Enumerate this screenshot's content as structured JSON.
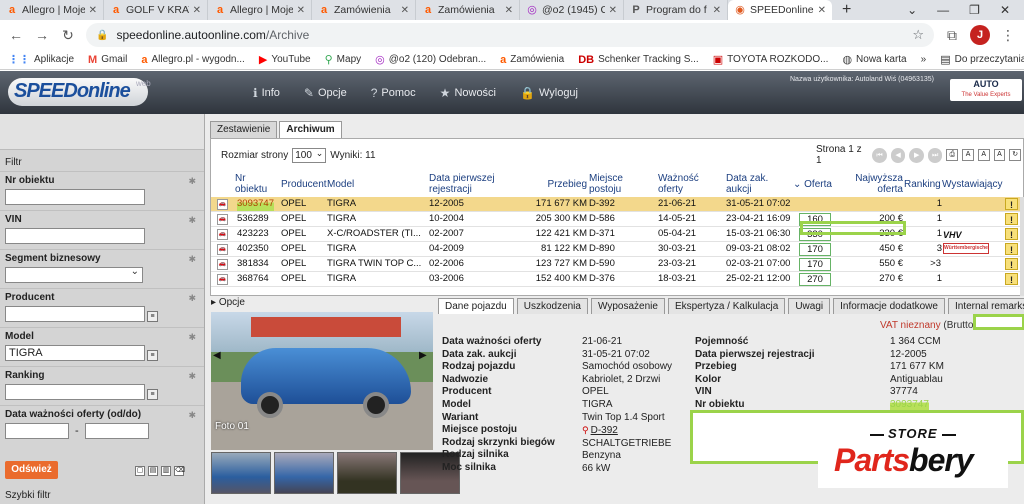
{
  "browser": {
    "tabs": [
      {
        "icon": "a",
        "label": "Allegro | Moje",
        "color": "#ff5a00",
        "active": false
      },
      {
        "icon": "a",
        "label": "GOLF V KRAT",
        "color": "#ff5a00",
        "active": false
      },
      {
        "icon": "a",
        "label": "Allegro | Moje",
        "color": "#ff5a00",
        "active": false
      },
      {
        "icon": "a",
        "label": "Zamówienia",
        "color": "#ff5a00",
        "active": false
      },
      {
        "icon": "a",
        "label": "Zamówienia",
        "color": "#ff5a00",
        "active": false
      },
      {
        "icon": "◎",
        "label": "@o2 (1945) C",
        "color": "#a020c0",
        "active": false
      },
      {
        "icon": "P",
        "label": "Program do f",
        "color": "#555555",
        "active": false
      },
      {
        "icon": "◉",
        "label": "SPEEDonline",
        "color": "#e05a20",
        "active": true
      }
    ],
    "url_domain": "speedonline.autoonline.com",
    "url_path": "/Archive",
    "avatar_letter": "J",
    "bookmarks": [
      {
        "icon": "⋮⋮",
        "label": "Aplikacje"
      },
      {
        "icon": "M",
        "label": "Gmail"
      },
      {
        "icon": "a",
        "label": "Allegro.pl - wygodn..."
      },
      {
        "icon": "▶",
        "label": "YouTube"
      },
      {
        "icon": "⚲",
        "label": "Mapy"
      },
      {
        "icon": "◎",
        "label": "@o2 (120) Odebran..."
      },
      {
        "icon": "a",
        "label": "Zamówienia"
      },
      {
        "icon": "DB",
        "label": "Schenker Tracking S..."
      },
      {
        "icon": "▣",
        "label": "TOYOTA ROZKODO..."
      },
      {
        "icon": "◍",
        "label": "Nowa karta"
      }
    ],
    "bookmarks_more": "»",
    "reading_list": "Do przeczytania"
  },
  "app": {
    "logo_speed": "SPEED",
    "logo_online": "online",
    "logo_web": "web",
    "nav": [
      {
        "icon": "ℹ",
        "label": "Info"
      },
      {
        "icon": "✎",
        "label": "Opcje"
      },
      {
        "icon": "?",
        "label": "Pomoc"
      },
      {
        "icon": "★",
        "label": "Nowości"
      },
      {
        "icon": "🔒",
        "label": "Wyloguj"
      }
    ],
    "user_info": "Nazwa użytkownika: Autoland Wiś (04963135)",
    "auto_logo": "AUTO",
    "auto_tagline": "The Value Experts"
  },
  "filter": {
    "title": "Filtr",
    "fields": [
      {
        "label": "Nr obiektu",
        "value": "",
        "type": "input"
      },
      {
        "label": "VIN",
        "value": "",
        "type": "input"
      },
      {
        "label": "Segment biznesowy",
        "value": "",
        "type": "select"
      },
      {
        "label": "Producent",
        "value": "",
        "type": "input-pick"
      },
      {
        "label": "Model",
        "value": "TIGRA",
        "type": "input-pick"
      },
      {
        "label": "Ranking",
        "value": "",
        "type": "input-pick"
      },
      {
        "label": "Data ważności oferty (od/do)",
        "value": "",
        "type": "date"
      }
    ],
    "date_separator": "-",
    "refresh_button": "Odśwież",
    "quick_filter": "Szybki filtr"
  },
  "main_tabs": [
    {
      "label": "Zestawienie",
      "active": false
    },
    {
      "label": "Archiwum",
      "active": true
    }
  ],
  "results": {
    "page_size_label": "Rozmiar strony",
    "page_size": "100",
    "results_label": "Wyniki: 11",
    "page_label": "Strona 1 z 1",
    "columns": [
      {
        "label": "Nr obiektu"
      },
      {
        "label": "Producent"
      },
      {
        "label": "Model"
      },
      {
        "label": "Data pierwszej rejestracji"
      },
      {
        "label": "Przebieg"
      },
      {
        "label": "Miejsce postoju"
      },
      {
        "label": "Ważność oferty"
      },
      {
        "label": "Data zak. aukcji"
      },
      {
        "label": "⌄ Oferta"
      },
      {
        "label": "Najwyższa oferta"
      },
      {
        "label": "Ranking"
      },
      {
        "label": "Wystawiający"
      }
    ],
    "rows": [
      {
        "id": "3093747",
        "producer": "OPEL",
        "model": "TIGRA",
        "reg": "12-2005",
        "mileage": "171 677 KM",
        "place": "D-392",
        "valid": "21-06-21",
        "end": "31-05-21 07:02",
        "offer": "",
        "top": "",
        "rank": "1",
        "seller": "",
        "selected": true
      },
      {
        "id": "536289",
        "producer": "OPEL",
        "model": "TIGRA",
        "reg": "10-2004",
        "mileage": "205 300 KM",
        "place": "D-586",
        "valid": "14-05-21",
        "end": "23-04-21 16:09",
        "offer": "160",
        "top": "200 €",
        "rank": "1",
        "seller": "",
        "selected": false
      },
      {
        "id": "423223",
        "producer": "OPEL",
        "model": "X-C/ROADSTER (TI...",
        "reg": "02-2007",
        "mileage": "122 421 KM",
        "place": "D-371",
        "valid": "05-04-21",
        "end": "15-03-21 06:30",
        "offer": "330",
        "top": "330 €",
        "rank": "1",
        "seller": "VHV",
        "selected": false
      },
      {
        "id": "402350",
        "producer": "OPEL",
        "model": "TIGRA",
        "reg": "04-2009",
        "mileage": "81 122 KM",
        "place": "D-890",
        "valid": "30-03-21",
        "end": "09-03-21 08:02",
        "offer": "170",
        "top": "450 €",
        "rank": "3",
        "seller": "Württembergische",
        "selected": false
      },
      {
        "id": "381834",
        "producer": "OPEL",
        "model": "TIGRA TWIN TOP C...",
        "reg": "02-2006",
        "mileage": "123 727 KM",
        "place": "D-590",
        "valid": "23-03-21",
        "end": "02-03-21 07:00",
        "offer": "170",
        "top": "550 €",
        "rank": ">3",
        "seller": "",
        "selected": false
      },
      {
        "id": "368764",
        "producer": "OPEL",
        "model": "TIGRA",
        "reg": "03-2006",
        "mileage": "152 400 KM",
        "place": "D-376",
        "valid": "18-03-21",
        "end": "25-02-21 12:00",
        "offer": "270",
        "top": "270 €",
        "rank": "1",
        "seller": "",
        "selected": false
      }
    ],
    "warning_icon": "!"
  },
  "opcje_label": "Opcje",
  "detail_tabs": [
    {
      "label": "Dane pojazdu",
      "active": true
    },
    {
      "label": "Uszkodzenia",
      "active": false
    },
    {
      "label": "Wyposażenie",
      "active": false
    },
    {
      "label": "Ekspertyza / Kalkulacja",
      "active": false
    },
    {
      "label": "Uwagi",
      "active": false
    },
    {
      "label": "Informacje dodatkowe",
      "active": false
    },
    {
      "label": "Internal remarks",
      "active": false
    }
  ],
  "photo_label": "Foto 01",
  "vat": {
    "text": "VAT nieznany",
    "brutto": "(Brutto)"
  },
  "details_left": [
    {
      "label": "Data ważności oferty",
      "value": "21-06-21"
    },
    {
      "label": "Data zak. aukcji",
      "value": "31-05-21 07:02"
    },
    {
      "label": "Rodzaj pojazdu",
      "value": "Samochód osobowy"
    },
    {
      "label": "Nadwozie",
      "value": "Kabriolet, 2 Drzwi"
    },
    {
      "label": "Producent",
      "value": "OPEL"
    },
    {
      "label": "Model",
      "value": "TIGRA"
    },
    {
      "label": "Wariant",
      "value": "Twin Top 1.4 Sport"
    },
    {
      "label": "Miejsce postoju",
      "value": "D-392"
    },
    {
      "label": "Rodzaj skrzynki biegów",
      "value": "SCHALTGETRIEBE"
    },
    {
      "label": "Rodzaj silnika",
      "value": "Benzyna"
    },
    {
      "label": "Moc silnika",
      "value": "66 kW"
    }
  ],
  "details_right": [
    {
      "label": "Pojemność",
      "value": "1 364 CCM"
    },
    {
      "label": "Data pierwszej rejestracji",
      "value": "12-2005"
    },
    {
      "label": "Przebieg",
      "value": "171 677 KM"
    },
    {
      "label": "Kolor",
      "value": "Antiguablau"
    },
    {
      "label": "VIN",
      "value": "37774"
    },
    {
      "label": "Nr obiektu",
      "value": "3093747"
    }
  ],
  "watermark": {
    "store": "STORE",
    "brand_red": "Parts",
    "brand_black": "bery"
  }
}
